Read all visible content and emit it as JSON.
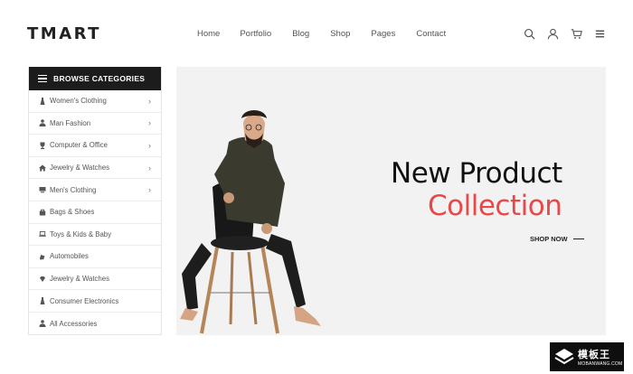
{
  "brand": {
    "logo": "TMART"
  },
  "nav": {
    "items": [
      "Home",
      "Portfolio",
      "Blog",
      "Shop",
      "Pages",
      "Contact"
    ]
  },
  "header_icons": [
    "search-icon",
    "user-icon",
    "cart-icon",
    "menu-icon"
  ],
  "sidebar": {
    "title": "BROWSE CATEGORIES",
    "items": [
      {
        "label": "Women's Clothing",
        "icon": "dress-icon",
        "has_submenu": true
      },
      {
        "label": "Man Fashion",
        "icon": "person-icon",
        "has_submenu": true
      },
      {
        "label": "Computer & Office",
        "icon": "trophy-icon",
        "has_submenu": true
      },
      {
        "label": "Jewelry & Watches",
        "icon": "home-icon",
        "has_submenu": true
      },
      {
        "label": "Men's Clothing",
        "icon": "monitor-icon",
        "has_submenu": true
      },
      {
        "label": "Bags & Shoes",
        "icon": "bag-icon",
        "has_submenu": false
      },
      {
        "label": "Toys & Kids & Baby",
        "icon": "laptop-icon",
        "has_submenu": false
      },
      {
        "label": "Automobiles",
        "icon": "car-icon",
        "has_submenu": false
      },
      {
        "label": "Jewelry & Watches",
        "icon": "gem-icon",
        "has_submenu": false
      },
      {
        "label": "Consumer Electronics",
        "icon": "electronics-icon",
        "has_submenu": false
      },
      {
        "label": "All Accessories",
        "icon": "person-icon",
        "has_submenu": false
      }
    ]
  },
  "hero": {
    "title_line1": "New Product",
    "title_line2": "Collection",
    "cta": "SHOP NOW"
  },
  "watermark": {
    "cn": "模板王",
    "en": "MOBANWANG.COM"
  },
  "colors": {
    "accent": "#e94848",
    "dark": "#1c1c1c",
    "hero_bg": "#f2f2f2"
  }
}
